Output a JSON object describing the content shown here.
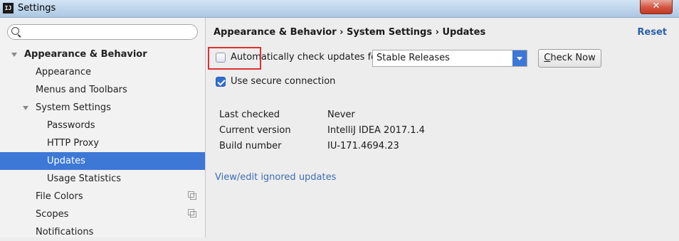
{
  "window": {
    "title": "Settings",
    "app_icon": "IJ",
    "close_glyph": "✕"
  },
  "sidebar": {
    "search": {
      "placeholder": "",
      "value": ""
    },
    "items": [
      {
        "label": "Appearance & Behavior",
        "level": 0,
        "expanded": true,
        "selected": false
      },
      {
        "label": "Appearance",
        "level": 1,
        "selected": false
      },
      {
        "label": "Menus and Toolbars",
        "level": 1,
        "selected": false
      },
      {
        "label": "System Settings",
        "level": 1,
        "expanded": true,
        "selected": false
      },
      {
        "label": "Passwords",
        "level": 2,
        "selected": false
      },
      {
        "label": "HTTP Proxy",
        "level": 2,
        "selected": false
      },
      {
        "label": "Updates",
        "level": 2,
        "selected": true
      },
      {
        "label": "Usage Statistics",
        "level": 2,
        "selected": false
      },
      {
        "label": "File Colors",
        "level": 1,
        "selected": false,
        "icon": "copy-icon"
      },
      {
        "label": "Scopes",
        "level": 1,
        "selected": false,
        "icon": "copy-icon"
      },
      {
        "label": "Notifications",
        "level": 1,
        "selected": false
      }
    ]
  },
  "main": {
    "breadcrumb": "Appearance & Behavior › System Settings › Updates",
    "reset_label": "Reset",
    "auto_check": {
      "label_prefix": "Auto",
      "label_rest": "matically check updates for",
      "checked": false
    },
    "channel_select": {
      "value": "Stable Releases"
    },
    "check_now": {
      "label_u": "C",
      "label_rest": "heck Now"
    },
    "secure_connection": {
      "label": "Use secure connection",
      "checked": true
    },
    "info": [
      {
        "key": "Last checked",
        "value": "Never"
      },
      {
        "key": "Current version",
        "value": "IntelliJ IDEA 2017.1.4"
      },
      {
        "key": "Build number",
        "value": "IU-171.4694.23"
      }
    ],
    "ignored_link": "View/edit ignored updates"
  },
  "colors": {
    "accent": "#3d78d6",
    "link": "#3c6db5",
    "highlight": "#e03030"
  }
}
